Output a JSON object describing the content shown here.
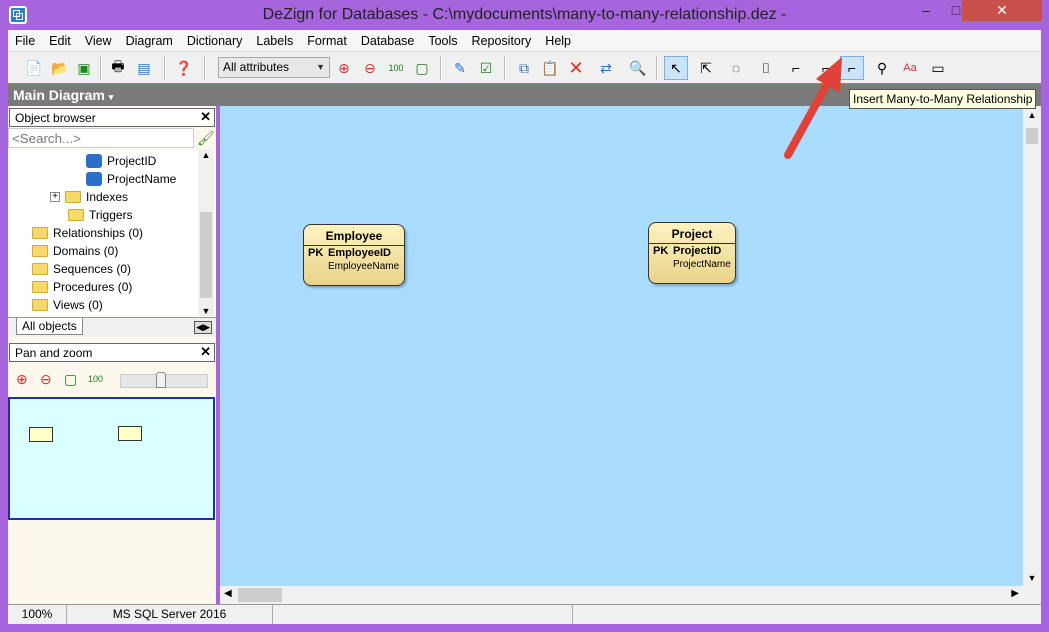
{
  "window": {
    "title": "DeZign for Databases - C:\\mydocuments\\many-to-many-relationship.dez -",
    "minimize": "–",
    "maximize": "□",
    "close": "✕"
  },
  "menu": [
    "File",
    "Edit",
    "View",
    "Diagram",
    "Dictionary",
    "Labels",
    "Format",
    "Database",
    "Tools",
    "Repository",
    "Help"
  ],
  "toolbar": {
    "attributes_combo": "All attributes",
    "tooltip": "Insert Many-to-Many Relationship"
  },
  "document_tab": {
    "label": "Main Diagram"
  },
  "object_browser": {
    "title": "Object browser",
    "search_placeholder": "<Search...>",
    "tree": [
      {
        "label": "ProjectID",
        "type": "pk-column"
      },
      {
        "label": "ProjectName",
        "type": "column"
      },
      {
        "label": "Indexes",
        "type": "folder"
      },
      {
        "label": "Triggers",
        "type": "folder"
      },
      {
        "label": "Relationships (0)",
        "type": "folder"
      },
      {
        "label": "Domains (0)",
        "type": "folder"
      },
      {
        "label": "Sequences (0)",
        "type": "folder"
      },
      {
        "label": "Procedures (0)",
        "type": "folder"
      },
      {
        "label": "Views (0)",
        "type": "folder"
      }
    ],
    "tab": "All objects"
  },
  "pan_zoom": {
    "title": "Pan and zoom",
    "zoom_slider": 0.5
  },
  "entities": [
    {
      "name": "Employee",
      "attributes": [
        {
          "key": "PK",
          "name": "EmployeeID"
        },
        {
          "key": "",
          "name": "EmployeeName"
        }
      ]
    },
    {
      "name": "Project",
      "attributes": [
        {
          "key": "PK",
          "name": "ProjectID"
        },
        {
          "key": "",
          "name": "ProjectName"
        }
      ]
    }
  ],
  "status": {
    "zoom": "100%",
    "dbms": "MS SQL Server 2016"
  }
}
